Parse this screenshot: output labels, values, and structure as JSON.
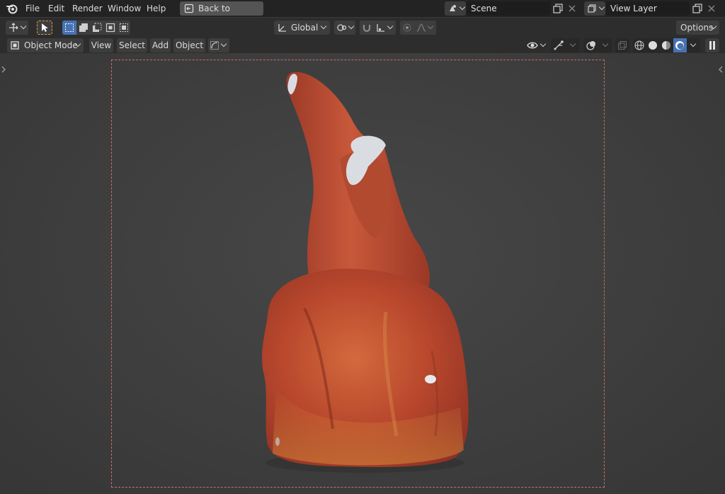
{
  "topbar": {
    "menus": [
      "File",
      "Edit",
      "Render",
      "Window",
      "Help"
    ],
    "back_button": "Back to Previous",
    "scene": {
      "value": "Scene"
    },
    "view_layer": {
      "value": "View Layer"
    }
  },
  "toolbar": {
    "orientation": "Global",
    "options_label": "Options"
  },
  "header": {
    "mode": "Object Mode",
    "menus": [
      "View",
      "Select",
      "Add",
      "Object"
    ]
  },
  "theme": {
    "accent": "#4772b3",
    "camera_frame": "#d06a6a",
    "background": "#3a3a3a"
  }
}
